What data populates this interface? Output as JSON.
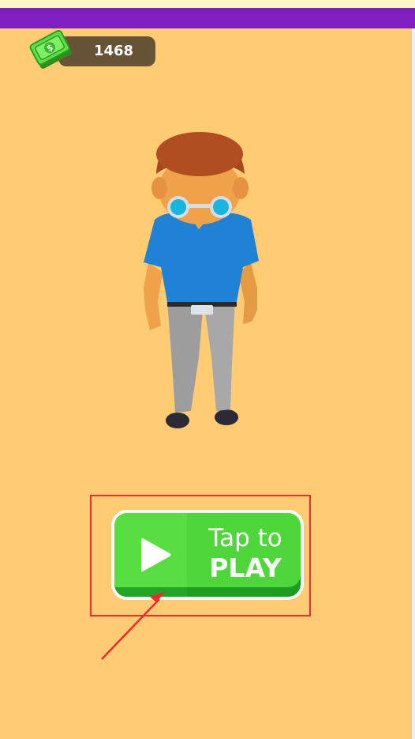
{
  "hud": {
    "currency": {
      "amount": "1468",
      "icon": "cash-icon"
    }
  },
  "play_button": {
    "line1": "Tap to",
    "line2": "PLAY",
    "icon": "play-icon"
  },
  "colors": {
    "background": "#ffcc73",
    "top_bar": "#7f1fc2",
    "button_green": "#4ed63a",
    "highlight": "#ef2b2b"
  }
}
